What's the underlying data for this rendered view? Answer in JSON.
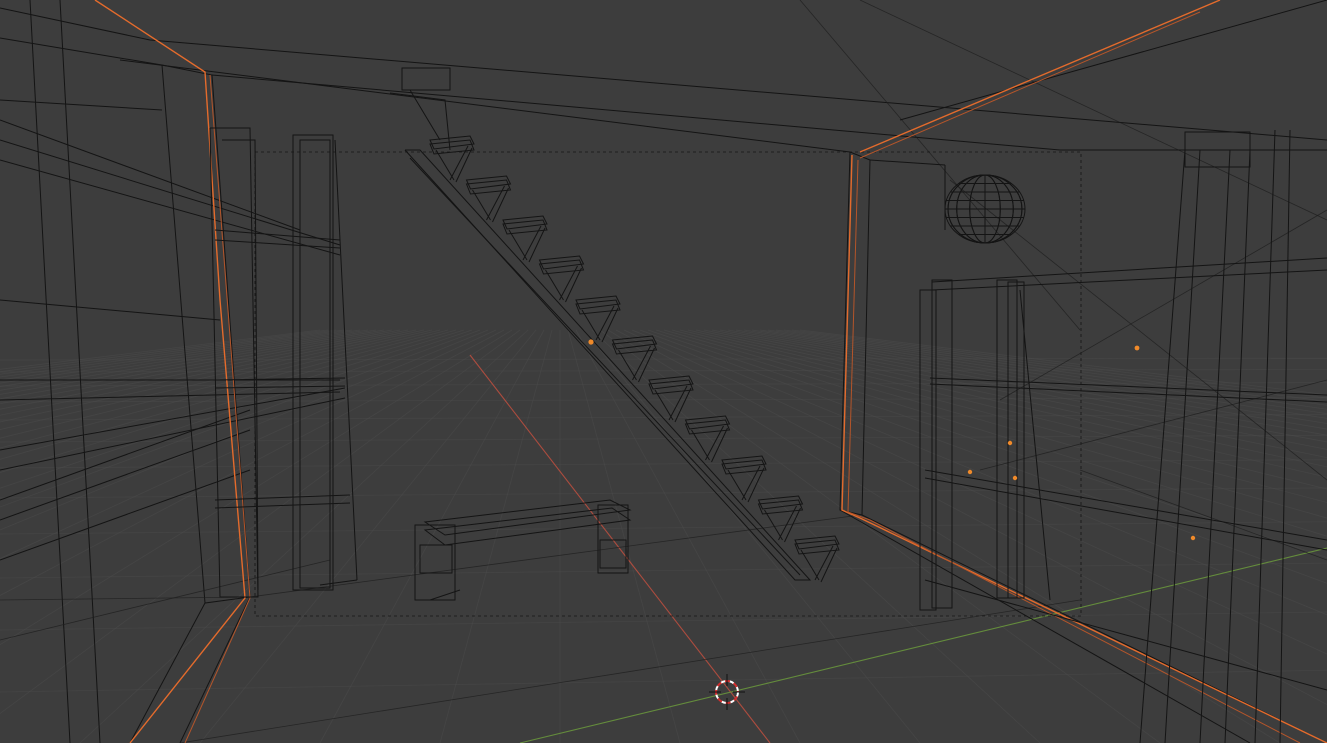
{
  "viewport": {
    "name": "3D Viewport",
    "shading_mode": "wireframe",
    "background_color": "#3d3d3d",
    "grid_color": "#4c4c4c",
    "wire_color": "#141414",
    "selected_outline_color": "#e46b2c",
    "x_axis_color": "#c8503f",
    "y_axis_color": "#6b9a3c",
    "origin_point_color": "#f08a2a",
    "camera_frame": "passepartout",
    "objects": [
      {
        "name": "walls",
        "selected": true
      },
      {
        "name": "staircase",
        "selected": false
      },
      {
        "name": "bench",
        "selected": false
      },
      {
        "name": "left-shelf",
        "selected": false
      },
      {
        "name": "right-shelf",
        "selected": false
      },
      {
        "name": "wall-lamp-sphere",
        "selected": false
      },
      {
        "name": "pillar",
        "selected": false
      }
    ],
    "cursor_icon": "3d-cursor-icon"
  }
}
